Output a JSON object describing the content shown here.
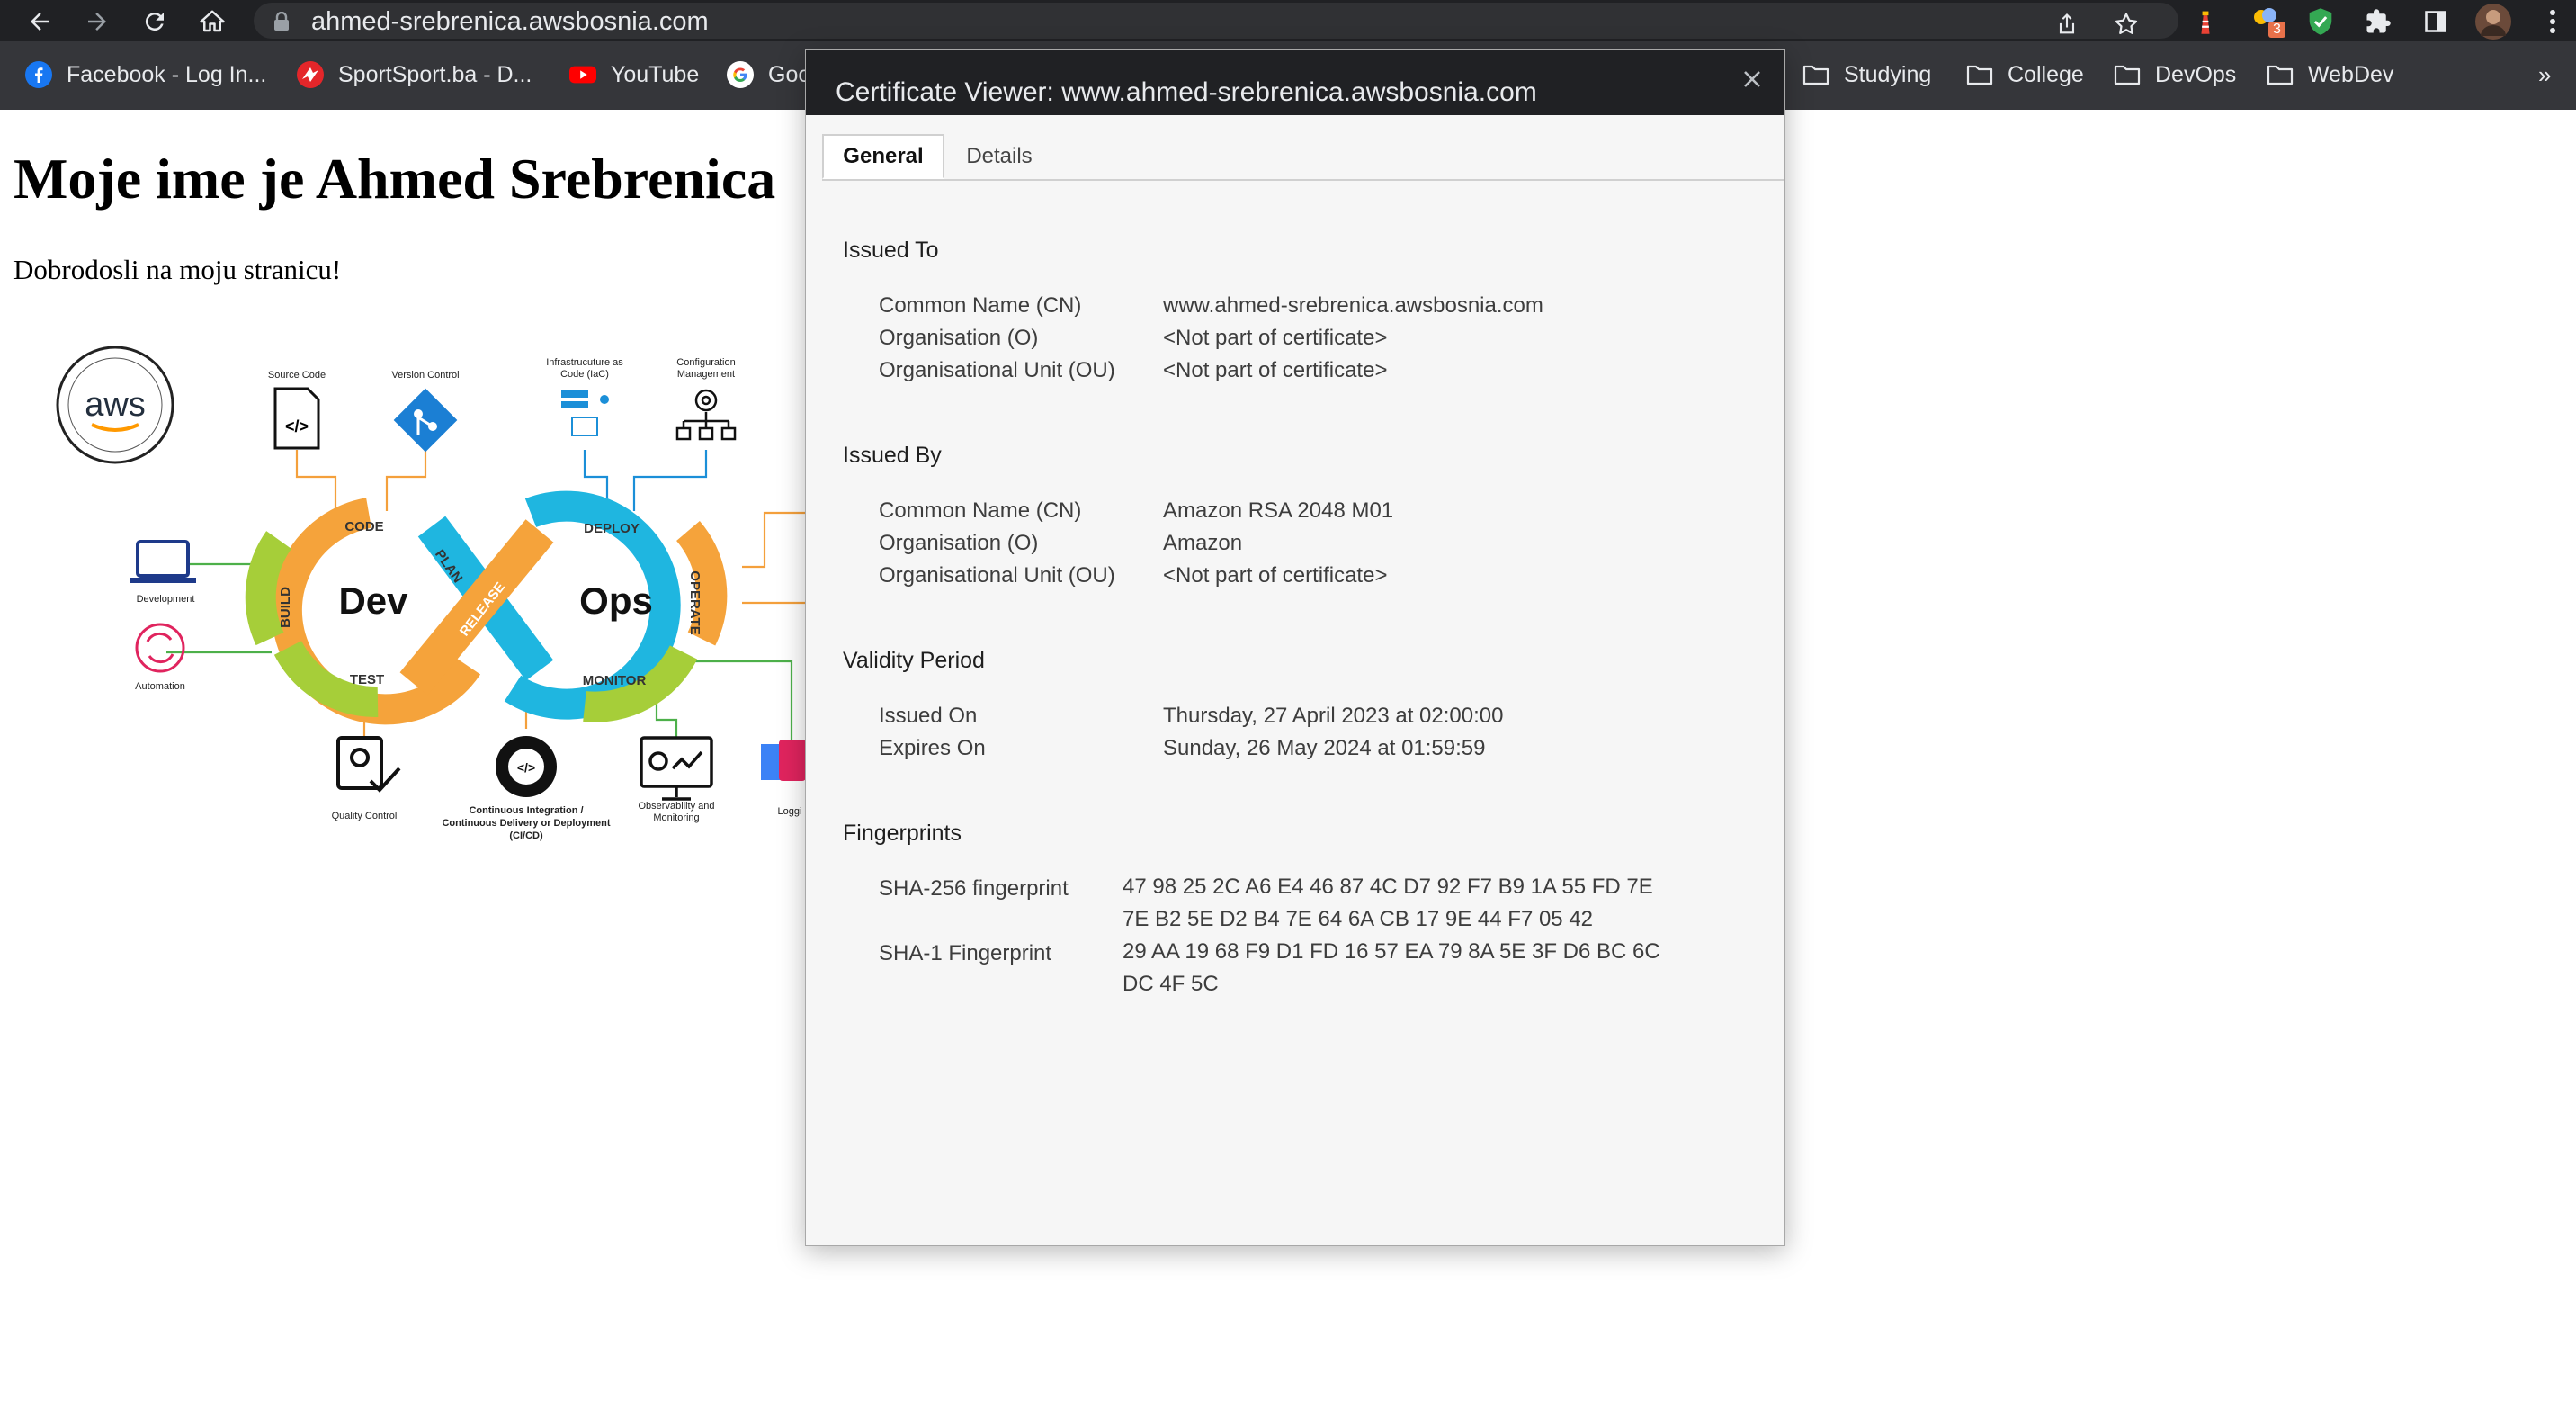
{
  "browser": {
    "url": "ahmed-srebrenica.awsbosnia.com",
    "extension_badge": "3",
    "bookmarks": [
      {
        "label": "Facebook - Log In...",
        "icon": "facebook-icon"
      },
      {
        "label": "SportSport.ba - D...",
        "icon": "sportsport-icon"
      },
      {
        "label": "YouTube",
        "icon": "youtube-icon"
      },
      {
        "label": "Goo",
        "icon": "google-icon"
      },
      {
        "label": "Studying",
        "icon": "folder-icon"
      },
      {
        "label": "College",
        "icon": "folder-icon"
      },
      {
        "label": "DevOps",
        "icon": "folder-icon"
      },
      {
        "label": "WebDev",
        "icon": "folder-icon"
      }
    ],
    "overflow": "»"
  },
  "page": {
    "title": "Moje ime je Ahmed Srebrenica",
    "subtitle": "Dobrodosli na moju stranicu!",
    "diagram": {
      "logo": "aws",
      "center_left": "Dev",
      "center_right": "Ops",
      "loop_labels": [
        "CODE",
        "PLAN",
        "BUILD",
        "TEST",
        "RELEASE",
        "DEPLOY",
        "OPERATE",
        "MONITOR"
      ],
      "icon_labels": {
        "source_code": "Source Code",
        "version_control": "Version Control",
        "iac": [
          "Infrastrucuture as",
          "Code (IaC)"
        ],
        "config": [
          "Configuration",
          "Management"
        ],
        "development": "Development",
        "automation": "Automation",
        "quality": "Quality Control",
        "cicd": [
          "Continuous Integration /",
          "Continuous Delivery or Deployment",
          "(CI/CD)"
        ],
        "observability": [
          "Observability and",
          "Monitoring"
        ],
        "logging": "Loggi"
      }
    }
  },
  "certificate": {
    "title": "Certificate Viewer: www.ahmed-srebrenica.awsbosnia.com",
    "tabs": [
      "General",
      "Details"
    ],
    "issued_to": {
      "heading": "Issued To",
      "cn_label": "Common Name (CN)",
      "cn": "www.ahmed-srebrenica.awsbosnia.com",
      "o_label": "Organisation (O)",
      "o": "<Not part of certificate>",
      "ou_label": "Organisational Unit (OU)",
      "ou": "<Not part of certificate>"
    },
    "issued_by": {
      "heading": "Issued By",
      "cn_label": "Common Name (CN)",
      "cn": "Amazon RSA 2048 M01",
      "o_label": "Organisation (O)",
      "o": "Amazon",
      "ou_label": "Organisational Unit (OU)",
      "ou": "<Not part of certificate>"
    },
    "validity": {
      "heading": "Validity Period",
      "issued_label": "Issued On",
      "issued": "Thursday, 27 April 2023 at 02:00:00",
      "expires_label": "Expires On",
      "expires": "Sunday, 26 May 2024 at 01:59:59"
    },
    "fingerprints": {
      "heading": "Fingerprints",
      "sha256_label": "SHA-256 fingerprint",
      "sha256": "47 98 25 2C A6 E4 46 87 4C D7 92 F7 B9 1A 55 FD 7E 7E B2 5E D2 B4 7E 64 6A CB 17 9E 44 F7 05 42",
      "sha1_label": "SHA-1 Fingerprint",
      "sha1": "29 AA 19 68 F9 D1 FD 16 57 EA 79 8A 5E 3F D6 BC 6C DC 4F 5C"
    }
  }
}
